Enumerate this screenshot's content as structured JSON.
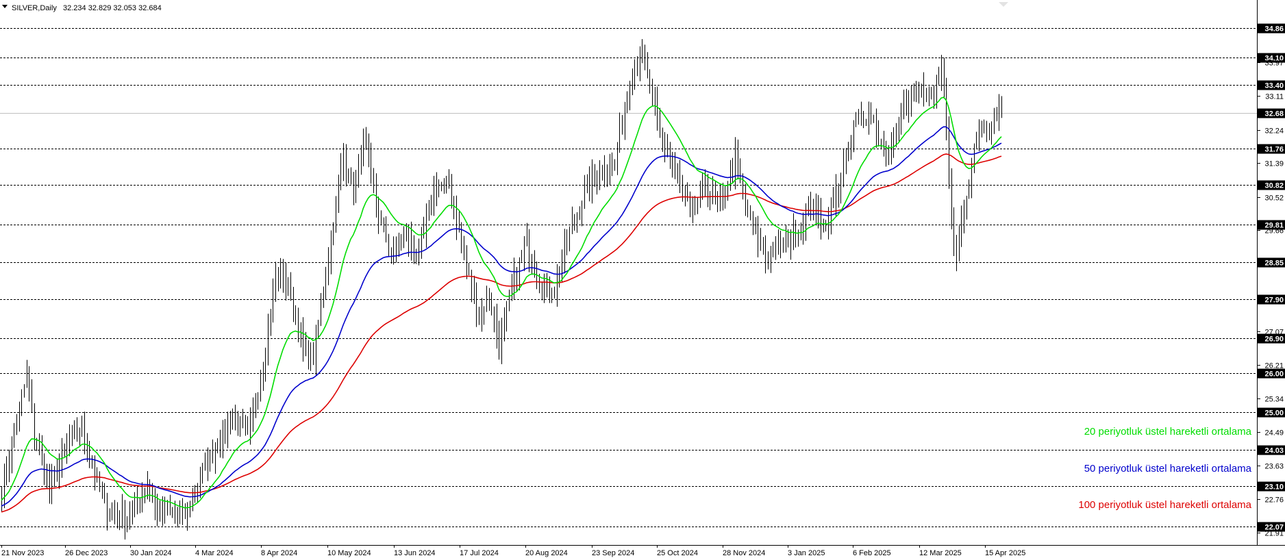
{
  "header": {
    "symbol": "SILVER,Daily",
    "ohlc": "32.234 32.829 32.053 32.684"
  },
  "legend": {
    "ema20": "20 periyotluk üstel hareketli ortalama",
    "ema50": "50 periyotluk üstel hareketli ortalama",
    "ema100": "100 periyotluk üstel hareketli ortalama"
  },
  "chart_data": {
    "type": "line",
    "instrument": "SILVER",
    "timeframe": "Daily",
    "last_close": 32.68,
    "ylim": [
      21.7,
      35.2
    ],
    "grid": false,
    "colors": {
      "candles": "#000000",
      "ema20": "#00dd00",
      "ema50": "#0000cc",
      "ema100": "#dd0000",
      "level_label_bg": "#000000",
      "current_price_line": "#c0c0c0"
    },
    "y_ticks": [
      "33.97",
      "33.11",
      "32.24",
      "31.39",
      "30.52",
      "29.66",
      "27.07",
      "26.21",
      "25.34",
      "24.49",
      "23.63",
      "22.76",
      "21.91"
    ],
    "level_lines": [
      "34.86",
      "34.10",
      "33.40",
      "32.68",
      "31.76",
      "30.82",
      "29.81",
      "28.85",
      "27.90",
      "26.90",
      "26.00",
      "25.00",
      "24.03",
      "23.10",
      "22.07"
    ],
    "x_ticks": [
      "21 Nov 2023",
      "26 Dec 2023",
      "30 Jan 2024",
      "4 Mar 2024",
      "8 Apr 2024",
      "10 May 2024",
      "13 Jun 2024",
      "17 Jul 2024",
      "20 Aug 2024",
      "23 Sep 2024",
      "25 Oct 2024",
      "28 Nov 2024",
      "3 Jan 2025",
      "6 Feb 2025",
      "12 Mar 2025",
      "15 Apr 2025"
    ],
    "price_anchors": [
      [
        0,
        23.0
      ],
      [
        6,
        24.8
      ],
      [
        10,
        25.9
      ],
      [
        13,
        24.4
      ],
      [
        19,
        23.0
      ],
      [
        27,
        24.3
      ],
      [
        32,
        24.6
      ],
      [
        38,
        23.2
      ],
      [
        42,
        22.5
      ],
      [
        50,
        22.3
      ],
      [
        58,
        23.2
      ],
      [
        62,
        22.4
      ],
      [
        66,
        22.5
      ],
      [
        72,
        22.2
      ],
      [
        78,
        23.2
      ],
      [
        86,
        24.2
      ],
      [
        92,
        25.0
      ],
      [
        98,
        24.3
      ],
      [
        104,
        26.3
      ],
      [
        109,
        28.5
      ],
      [
        114,
        28.3
      ],
      [
        117,
        27.3
      ],
      [
        120,
        26.6
      ],
      [
        124,
        26.4
      ],
      [
        130,
        29.0
      ],
      [
        136,
        31.6
      ],
      [
        140,
        30.7
      ],
      [
        144,
        32.0
      ],
      [
        150,
        30.0
      ],
      [
        156,
        29.0
      ],
      [
        160,
        29.6
      ],
      [
        166,
        29.0
      ],
      [
        172,
        30.8
      ],
      [
        178,
        30.8
      ],
      [
        184,
        29.0
      ],
      [
        190,
        27.5
      ],
      [
        194,
        28.0
      ],
      [
        198,
        26.7
      ],
      [
        204,
        28.4
      ],
      [
        209,
        29.4
      ],
      [
        214,
        28.3
      ],
      [
        220,
        28.1
      ],
      [
        226,
        29.6
      ],
      [
        232,
        30.6
      ],
      [
        238,
        31.2
      ],
      [
        244,
        31.4
      ],
      [
        250,
        33.5
      ],
      [
        254,
        34.3
      ],
      [
        258,
        33.4
      ],
      [
        262,
        32.1
      ],
      [
        268,
        31.2
      ],
      [
        274,
        30.1
      ],
      [
        280,
        30.8
      ],
      [
        286,
        30.3
      ],
      [
        292,
        31.5
      ],
      [
        298,
        29.8
      ],
      [
        304,
        29.0
      ],
      [
        310,
        29.3
      ],
      [
        316,
        29.6
      ],
      [
        322,
        30.2
      ],
      [
        328,
        29.8
      ],
      [
        334,
        31.0
      ],
      [
        340,
        32.5
      ],
      [
        346,
        32.7
      ],
      [
        352,
        31.4
      ],
      [
        358,
        32.7
      ],
      [
        364,
        33.2
      ],
      [
        370,
        33.0
      ],
      [
        374,
        34.0
      ],
      [
        378,
        30.2
      ],
      [
        380,
        28.8
      ],
      [
        384,
        30.6
      ],
      [
        388,
        32.2
      ],
      [
        392,
        32.4
      ],
      [
        398,
        32.68
      ]
    ]
  }
}
